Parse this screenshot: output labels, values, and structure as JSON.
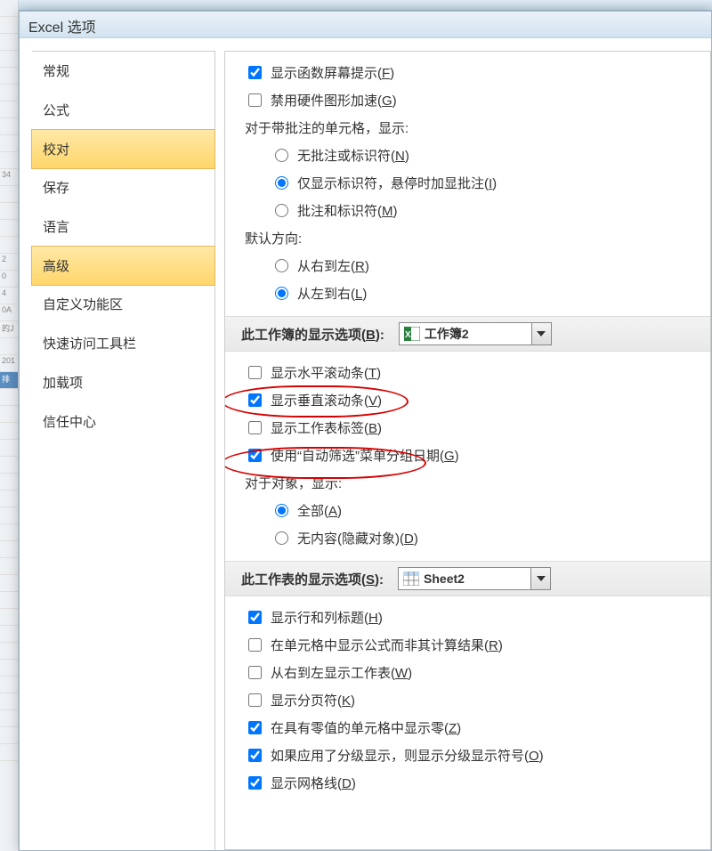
{
  "window": {
    "title": "Excel 选项"
  },
  "sidebar": {
    "items": [
      {
        "label": "常规"
      },
      {
        "label": "公式"
      },
      {
        "label": "校对"
      },
      {
        "label": "保存"
      },
      {
        "label": "语言"
      },
      {
        "label": "高级"
      },
      {
        "label": "自定义功能区"
      },
      {
        "label": "快速访问工具栏"
      },
      {
        "label": "加载项"
      },
      {
        "label": "信任中心"
      }
    ],
    "selected_indices": [
      2,
      5
    ]
  },
  "options": {
    "show_fn_tooltip": {
      "label": "显示函数屏幕提示(",
      "hotkey": "F",
      "suffix": ")",
      "checked": true
    },
    "disable_hw_accel": {
      "label": "禁用硬件图形加速(",
      "hotkey": "G",
      "suffix": ")",
      "checked": false
    },
    "comment_group_label": "对于带批注的单元格，显示:",
    "comment_none": {
      "label": "无批注或标识符(",
      "hotkey": "N",
      "suffix": ")",
      "checked": false
    },
    "comment_indicator": {
      "label": "仅显示标识符，悬停时加显批注(",
      "hotkey": "I",
      "suffix": ")",
      "checked": true
    },
    "comment_both": {
      "label": "批注和标识符(",
      "hotkey": "M",
      "suffix": ")",
      "checked": false
    },
    "direction_label": "默认方向:",
    "dir_rtl": {
      "label": "从右到左(",
      "hotkey": "R",
      "suffix": ")",
      "checked": false
    },
    "dir_ltr": {
      "label": "从左到右(",
      "hotkey": "L",
      "suffix": ")",
      "checked": true
    }
  },
  "workbook_section": {
    "title": "此工作簿的显示选项(",
    "hotkey": "B",
    "suffix": "):",
    "dropdown_value": "工作簿2",
    "show_hscroll": {
      "label": "显示水平滚动条(",
      "hotkey": "T",
      "suffix": ")",
      "checked": false
    },
    "show_vscroll": {
      "label": "显示垂直滚动条(",
      "hotkey": "V",
      "suffix": ")",
      "checked": true
    },
    "show_tabs": {
      "label": "显示工作表标签(",
      "hotkey": "B",
      "suffix": ")",
      "checked": false
    },
    "autofilter_group": {
      "label": "使用“自动筛选”菜单分组日期(",
      "hotkey": "G",
      "suffix": ")",
      "checked": true
    },
    "objects_label": "对于对象，显示:",
    "obj_all": {
      "label": "全部(",
      "hotkey": "A",
      "suffix": ")",
      "checked": true
    },
    "obj_none": {
      "label": "无内容(隐藏对象)(",
      "hotkey": "D",
      "suffix": ")",
      "checked": false
    }
  },
  "sheet_section": {
    "title": "此工作表的显示选项(",
    "hotkey": "S",
    "suffix": "):",
    "dropdown_value": "Sheet2",
    "show_headers": {
      "label": "显示行和列标题(",
      "hotkey": "H",
      "suffix": ")",
      "checked": true
    },
    "show_formulas": {
      "label": "在单元格中显示公式而非其计算结果(",
      "hotkey": "R",
      "suffix": ")",
      "checked": false
    },
    "rtl_sheet": {
      "label": "从右到左显示工作表(",
      "hotkey": "W",
      "suffix": ")",
      "checked": false
    },
    "show_pagebreaks": {
      "label": "显示分页符(",
      "hotkey": "K",
      "suffix": ")",
      "checked": false
    },
    "show_zero": {
      "label": "在具有零值的单元格中显示零(",
      "hotkey": "Z",
      "suffix": ")",
      "checked": true
    },
    "show_outline": {
      "label": "如果应用了分级显示，则显示分级显示符号(",
      "hotkey": "O",
      "suffix": ")",
      "checked": true
    },
    "show_grid": {
      "label": "显示网格线(",
      "hotkey": "D",
      "suffix": ")",
      "checked": true
    }
  },
  "backdrop_rows": [
    "",
    "",
    "",
    "34",
    "",
    "",
    "",
    "",
    "2",
    "0",
    "4",
    "0A",
    "的J",
    "",
    "201",
    "排"
  ]
}
